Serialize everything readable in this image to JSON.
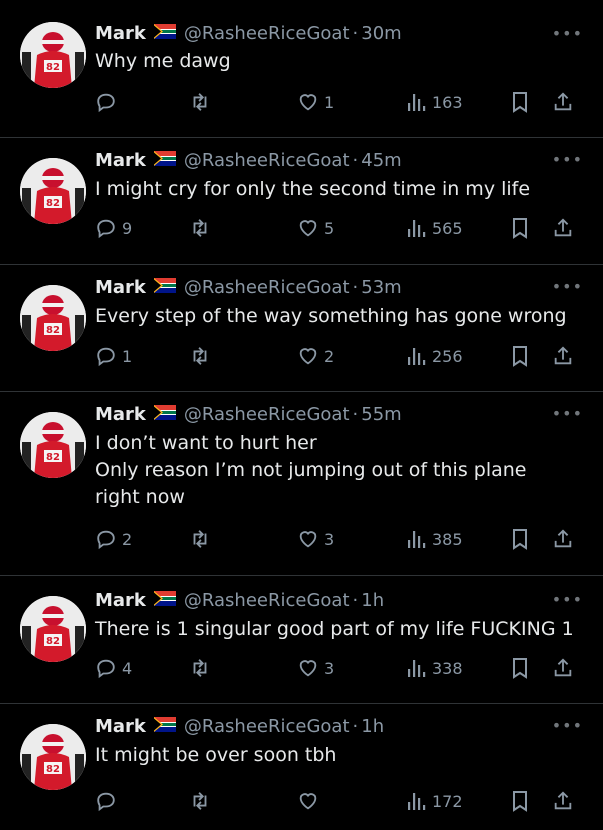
{
  "tweets": [
    {
      "name": "Mark",
      "handle": "@RasheeRiceGoat",
      "time": "30m",
      "lines": [
        "Why me dawg"
      ],
      "replies": "",
      "likes": "1",
      "views": "163"
    },
    {
      "name": "Mark",
      "handle": "@RasheeRiceGoat",
      "time": "45m",
      "lines": [
        "I might cry for only the second time in my life"
      ],
      "replies": "9",
      "likes": "5",
      "views": "565"
    },
    {
      "name": "Mark",
      "handle": "@RasheeRiceGoat",
      "time": "53m",
      "lines": [
        "Every step of the way something has gone wrong"
      ],
      "replies": "1",
      "likes": "2",
      "views": "256"
    },
    {
      "name": "Mark",
      "handle": "@RasheeRiceGoat",
      "time": "55m",
      "lines": [
        "I don’t want to hurt her",
        "Only reason I’m not jumping out of this plane",
        "right now"
      ],
      "replies": "2",
      "likes": "3",
      "views": "385"
    },
    {
      "name": "Mark",
      "handle": "@RasheeRiceGoat",
      "time": "1h",
      "lines": [
        "There is 1 singular good part of my life FUCKING 1"
      ],
      "replies": "4",
      "likes": "3",
      "views": "338"
    },
    {
      "name": "Mark",
      "handle": "@RasheeRiceGoat",
      "time": "1h",
      "lines": [
        "It might be over soon tbh"
      ],
      "replies": "",
      "likes": "",
      "views": "172"
    }
  ],
  "icons": {
    "reply": "reply-icon",
    "retweet": "retweet-icon",
    "like": "heart-icon",
    "views": "views-icon",
    "bookmark": "bookmark-icon",
    "share": "share-icon",
    "more": "more-icon",
    "flag": "south-africa-flag-icon"
  },
  "colors": {
    "background": "#000000",
    "text": "#e7e9ea",
    "muted": "#8b98a5",
    "divider": "#2f3336",
    "jersey_red": "#d31a2b"
  }
}
